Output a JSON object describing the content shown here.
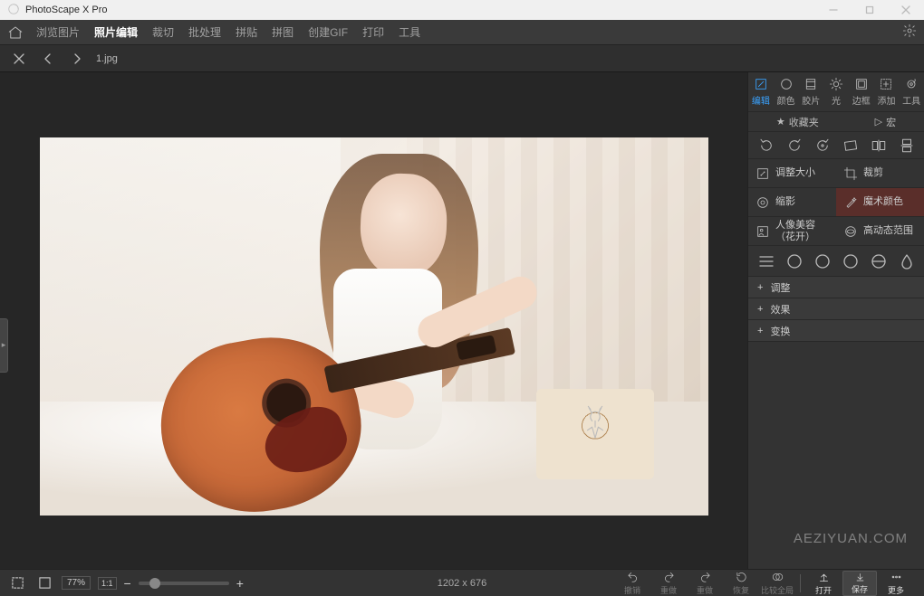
{
  "app": {
    "title": "PhotoScape X Pro"
  },
  "tabs": [
    "浏览图片",
    "照片编辑",
    "裁切",
    "批处理",
    "拼贴",
    "拼图",
    "创建GIF",
    "打印",
    "工具"
  ],
  "active_tab_index": 1,
  "file": {
    "name": "1.jpg"
  },
  "right_panel": {
    "top": [
      "编辑",
      "颜色",
      "胶片",
      "光",
      "边框",
      "添加",
      "工具"
    ],
    "top_active": 0,
    "fav": "收藏夹",
    "macro": "宏",
    "tools": {
      "resize": "调整大小",
      "crop": "裁剪",
      "vig": "缩影",
      "magic": "魔术颜色",
      "beauty": "人像美容（花开）",
      "hdr": "高动态范围"
    },
    "accordions": [
      "调整",
      "效果",
      "变换"
    ]
  },
  "bottom": {
    "zoom": "77%",
    "one": "1:1",
    "dims": "1202 x 676",
    "undo": "撤销",
    "redo": "重做",
    "redo2": "重做",
    "revert": "恢复",
    "compare": "比较全局",
    "open": "打开",
    "save": "保存",
    "more": "更多"
  },
  "watermark": "AEZIYUAN.COM"
}
